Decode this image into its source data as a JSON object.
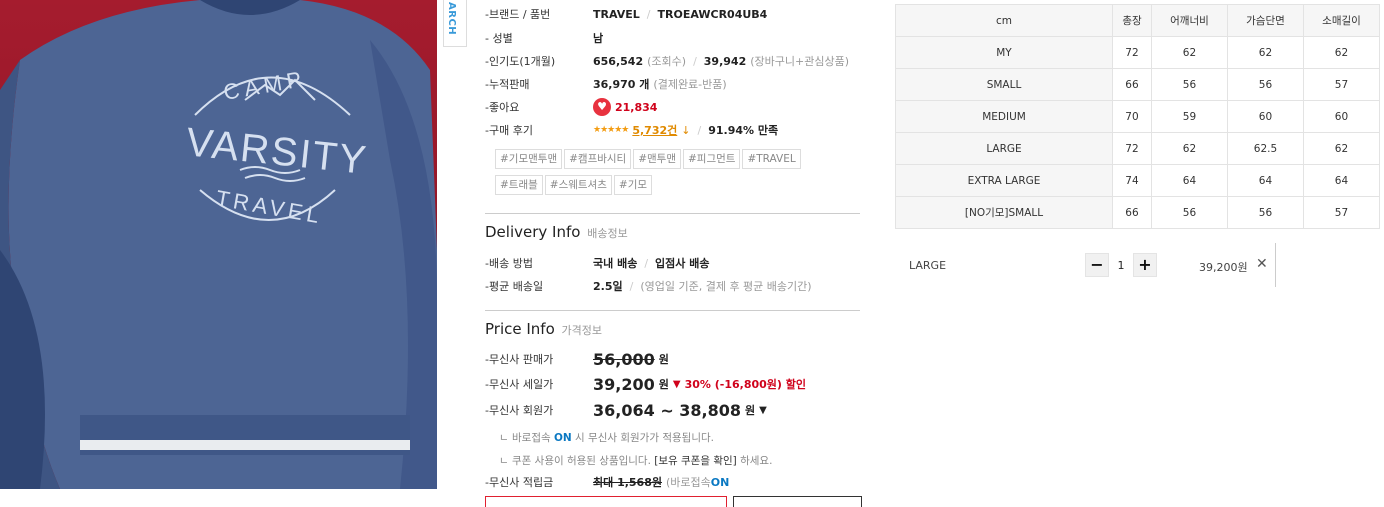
{
  "photo": {
    "print_line1": "CAMP",
    "print_line2": "VARSITY",
    "print_line3": "TRAVEL"
  },
  "side_tab": {
    "label": "ARCH"
  },
  "info": {
    "brand": {
      "label": "-브랜드 / 품번",
      "brand": "TRAVEL",
      "code": "TROEAWCR04UB4"
    },
    "gender": {
      "label": "- 성별",
      "value": "남"
    },
    "popularity": {
      "label": "-인기도(1개월)",
      "views": "656,542",
      "views_unit": "(조회수)",
      "carts": "39,942",
      "carts_unit": "(장바구니+관심상품)"
    },
    "sales": {
      "label": "-누적판매",
      "value": "36,970 개",
      "note": "(결제완료-반품)"
    },
    "likes": {
      "label": "-좋아요",
      "value": "21,834"
    },
    "reviews": {
      "label": "-구매 후기",
      "stars": "★★★★★",
      "count": "5,732건",
      "arrow": "↓",
      "satisfaction": "91.94% 만족"
    },
    "tags": [
      "#기모맨투맨",
      "#캠프바시티",
      "#맨투맨",
      "#피그먼트",
      "#TRAVEL",
      "#트래블",
      "#스웨트셔츠",
      "#기모"
    ]
  },
  "delivery": {
    "title": "Delivery Info",
    "subtitle": "배송정보",
    "method": {
      "label": "-배송 방법",
      "value1": "국내 배송",
      "value2": "입점사 배송"
    },
    "avg": {
      "label": "-평균 배송일",
      "value": "2.5일",
      "note": "(영업일 기준, 결제 후 평균 배송기간)"
    }
  },
  "price": {
    "title": "Price Info",
    "subtitle": "가격정보",
    "list": {
      "label": "-무신사 판매가",
      "value": "56,000",
      "unit": "원"
    },
    "sale": {
      "label": "-무신사 세일가",
      "value": "39,200",
      "unit": "원",
      "arrow": "▼",
      "discount": "30% (-16,800원) 할인"
    },
    "member": {
      "label": "-무신사 회원가",
      "value": "36,064 ~ 38,808",
      "unit": "원",
      "toggle": "▼"
    },
    "note1": {
      "prefix": "ㄴ 바로접속 ",
      "on": "ON",
      "suffix": " 시 무신사 회원가가 적용됩니다."
    },
    "note2": {
      "text": "ㄴ 쿠폰 사용이 허용된 상품입니다. ",
      "bold": "[보유 쿠폰을 확인]",
      "suffix": " 하세요."
    },
    "points": {
      "label": "-무신사 적립금",
      "value": "최대 1,568원",
      "note": "(바로접속 ",
      "on": "ON"
    }
  },
  "size_table": {
    "headers": [
      "cm",
      "총장",
      "어깨너비",
      "가슴단면",
      "소매길이"
    ],
    "rows": [
      [
        "MY",
        "72",
        "62",
        "62",
        "62"
      ],
      [
        "SMALL",
        "66",
        "56",
        "56",
        "57"
      ],
      [
        "MEDIUM",
        "70",
        "59",
        "60",
        "60"
      ],
      [
        "LARGE",
        "72",
        "62",
        "62.5",
        "62"
      ],
      [
        "EXTRA LARGE",
        "74",
        "64",
        "64",
        "64"
      ],
      [
        "[NO기모]SMALL",
        "66",
        "56",
        "56",
        "57"
      ]
    ]
  },
  "selected_option": {
    "name": "LARGE",
    "minus": "−",
    "qty": "1",
    "plus": "+",
    "price": "39,200원",
    "remove": "✕"
  },
  "colors": {
    "photo_bg": "#a51c2e",
    "sweatshirt": "#4d6594",
    "accent_red": "#d0021b",
    "accent_blue": "#0a78c2",
    "heart": "#e8323f",
    "stars": "#f39c12"
  }
}
